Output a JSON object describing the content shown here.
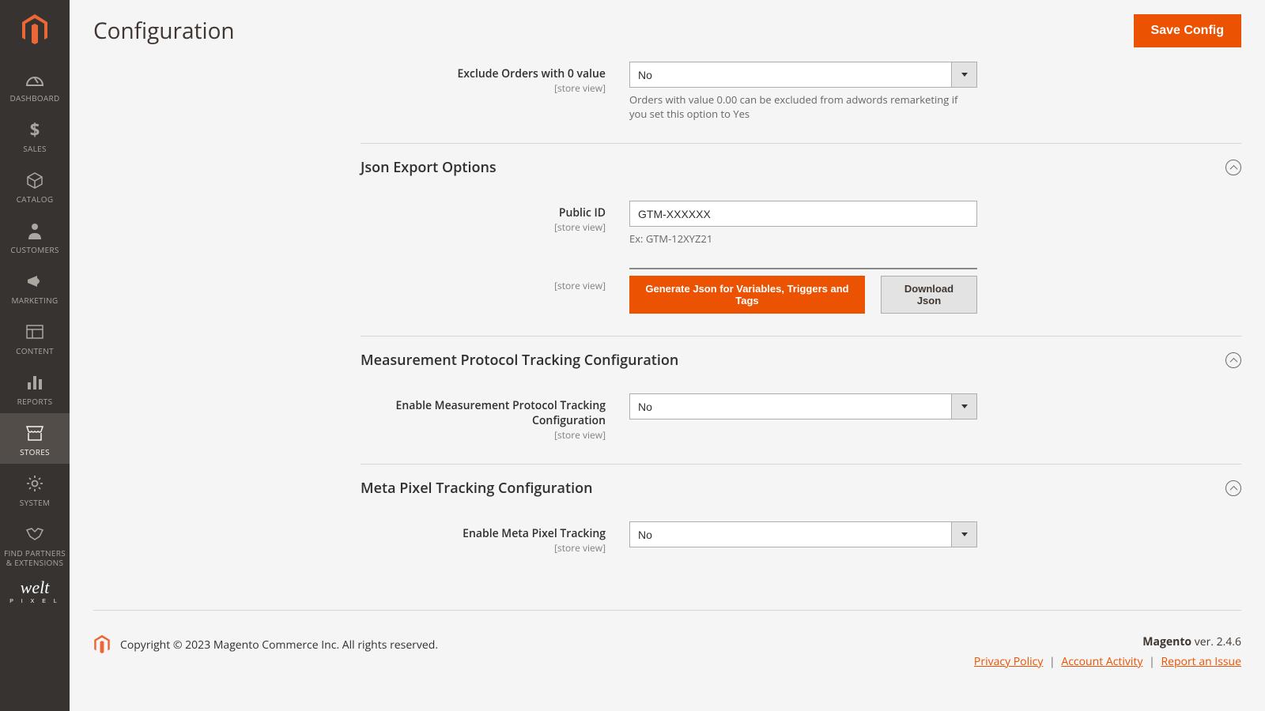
{
  "sidebar": {
    "items": [
      {
        "label": "DASHBOARD"
      },
      {
        "label": "SALES"
      },
      {
        "label": "CATALOG"
      },
      {
        "label": "CUSTOMERS"
      },
      {
        "label": "MARKETING"
      },
      {
        "label": "CONTENT"
      },
      {
        "label": "REPORTS"
      },
      {
        "label": "STORES"
      },
      {
        "label": "SYSTEM"
      },
      {
        "label": "FIND PARTNERS & EXTENSIONS"
      }
    ],
    "welt_label": "welt",
    "welt_sub": "P I X E L"
  },
  "header": {
    "title": "Configuration",
    "save_label": "Save Config"
  },
  "fields": {
    "exclude_orders": {
      "label": "Exclude Orders with 0 value",
      "scope": "[store view]",
      "value": "No",
      "note": "Orders with value 0.00 can be excluded from adwords remarketing if you set this option to Yes"
    },
    "json_export": {
      "title": "Json Export Options",
      "public_id": {
        "label": "Public ID",
        "scope": "[store view]",
        "value": "GTM-XXXXXX",
        "note": "Ex: GTM-12XYZ21"
      },
      "generate": {
        "scope": "[store view]",
        "btn_generate": "Generate Json for Variables, Triggers and Tags",
        "btn_download": "Download Json"
      }
    },
    "measurement": {
      "title": "Measurement Protocol Tracking Configuration",
      "enable": {
        "label": "Enable Measurement Protocol Tracking Configuration",
        "scope": "[store view]",
        "value": "No"
      }
    },
    "meta_pixel": {
      "title": "Meta Pixel Tracking Configuration",
      "enable": {
        "label": "Enable Meta Pixel Tracking",
        "scope": "[store view]",
        "value": "No"
      }
    }
  },
  "footer": {
    "copyright": "Copyright © 2023 Magento Commerce Inc. All rights reserved.",
    "brand": "Magento",
    "version": " ver. 2.4.6",
    "privacy": "Privacy Policy",
    "activity": " Account Activity",
    "report": "Report an Issue"
  }
}
